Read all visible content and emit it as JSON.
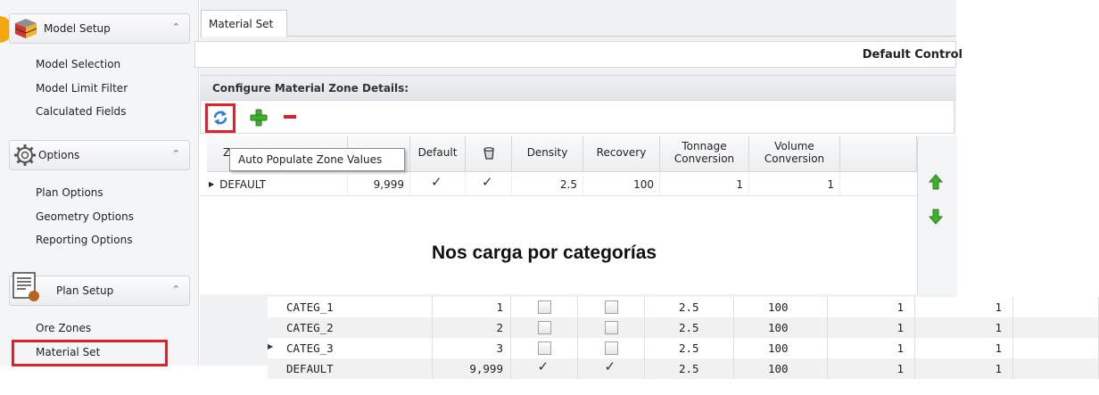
{
  "sidebar": {
    "model_setup": {
      "title": "Model Setup",
      "items": [
        "Model Selection",
        "Model Limit Filter",
        "Calculated Fields"
      ]
    },
    "options": {
      "title": "Options",
      "items": [
        "Plan Options",
        "Geometry Options",
        "Reporting Options"
      ]
    },
    "plan_setup": {
      "title": "Plan Setup",
      "items": [
        "Ore Zones",
        "Material Set"
      ]
    }
  },
  "main": {
    "tab": "Material Set",
    "title": "Default Control",
    "section": "Configure Material Zone Details:",
    "tooltip": "Auto Populate Zone Values",
    "columns": {
      "zone": "Z",
      "default": "Default",
      "density": "Density",
      "recovery": "Recovery",
      "tonnage": "Tonnage Conversion",
      "volume": "Volume Conversion"
    },
    "row": {
      "name": "DEFAULT",
      "code": "9,999",
      "default_checked": true,
      "waste_checked": true,
      "density": "2.5",
      "recovery": "100",
      "tonnage": "1",
      "volume": "1"
    }
  },
  "caption": "Nos carga por categorías",
  "lower_table": [
    {
      "name": "CATEG_1",
      "code": "1",
      "c1": false,
      "c2": false,
      "density": "2.5",
      "recovery": "100",
      "tonnage": "1",
      "volume": "1",
      "current": false
    },
    {
      "name": "CATEG_2",
      "code": "2",
      "c1": false,
      "c2": false,
      "density": "2.5",
      "recovery": "100",
      "tonnage": "1",
      "volume": "1",
      "current": false
    },
    {
      "name": "CATEG_3",
      "code": "3",
      "c1": false,
      "c2": false,
      "density": "2.5",
      "recovery": "100",
      "tonnage": "1",
      "volume": "1",
      "current": true
    },
    {
      "name": "DEFAULT",
      "code": "9,999",
      "c1": true,
      "c2": true,
      "density": "2.5",
      "recovery": "100",
      "tonnage": "1",
      "volume": "1",
      "current": false
    }
  ],
  "colors": {
    "highlight": "#e0202a",
    "add": "#3fb02b",
    "remove": "#e02020",
    "refresh": "#2a7ad6",
    "accent": "#f3a712"
  }
}
